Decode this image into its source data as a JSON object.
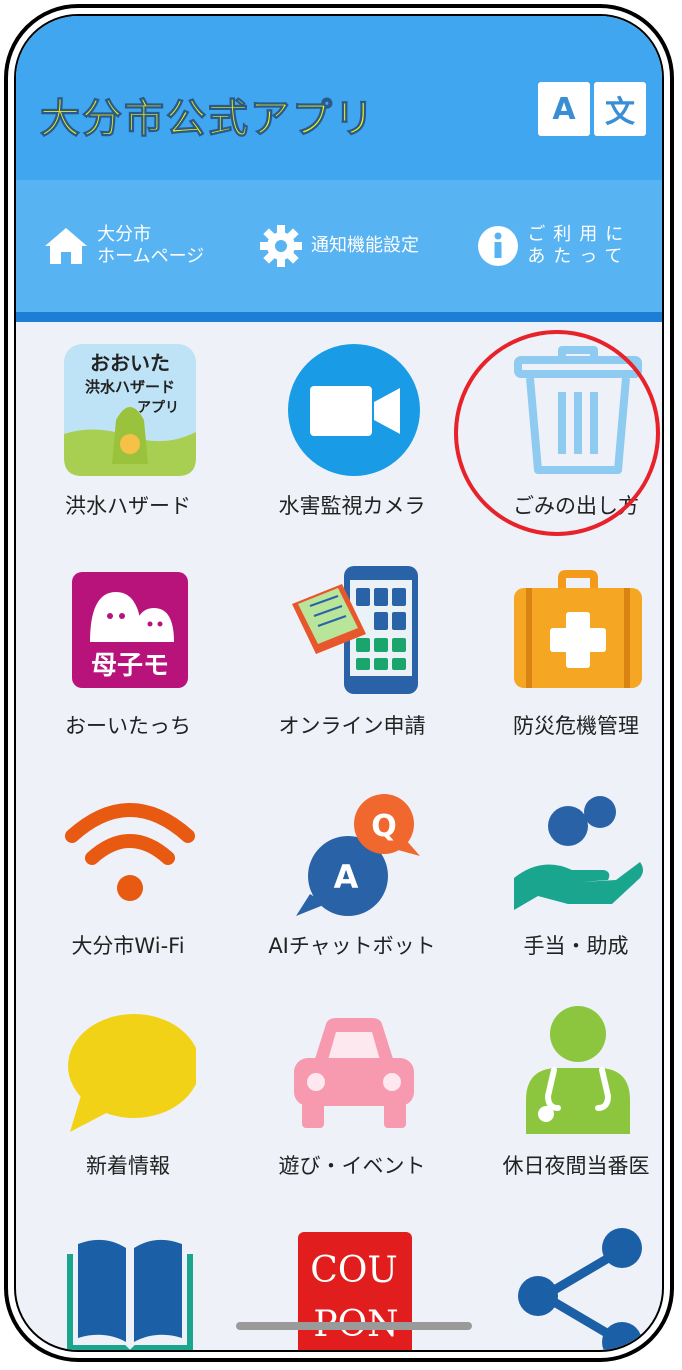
{
  "header": {
    "title": "大分市公式アプリ",
    "lang_a": "A",
    "lang_b": "文"
  },
  "nav": [
    {
      "label_1": "大分市",
      "label_2": "ホームページ",
      "icon": "home-icon"
    },
    {
      "label_1": "通知機能設定",
      "label_2": "",
      "icon": "gear-icon"
    },
    {
      "label_1": "ご利用に",
      "label_2": "あたって",
      "icon": "info-icon"
    }
  ],
  "tiles": [
    {
      "label": "洪水ハザード",
      "icon": "flood-hazard-app-icon",
      "badge_1": "おおいた",
      "badge_2": "洪水ハザード",
      "badge_3": "アプリ"
    },
    {
      "label": "水害監視カメラ",
      "icon": "video-camera-icon"
    },
    {
      "label": "ごみの出し方",
      "icon": "trash-can-icon"
    },
    {
      "label": "おーいたっち",
      "icon": "mother-child-app-icon",
      "badge_1": "母子モ"
    },
    {
      "label": "オンライン申請",
      "icon": "online-application-icon"
    },
    {
      "label": "防災危機管理",
      "icon": "first-aid-kit-icon"
    },
    {
      "label": "大分市Wi-Fi",
      "icon": "wifi-icon"
    },
    {
      "label": "AIチャットボット",
      "icon": "chat-qa-icon",
      "q": "Q",
      "a": "A"
    },
    {
      "label": "手当・助成",
      "icon": "hand-support-icon"
    },
    {
      "label": "新着情報",
      "icon": "speech-bubble-icon"
    },
    {
      "label": "遊び・イベント",
      "icon": "car-icon"
    },
    {
      "label": "休日夜間当番医",
      "icon": "doctor-icon"
    },
    {
      "label": "",
      "icon": "book-icon"
    },
    {
      "label": "",
      "icon": "coupon-icon",
      "coupon_1": "COU",
      "coupon_2": "PON"
    },
    {
      "label": "",
      "icon": "share-icon"
    }
  ]
}
